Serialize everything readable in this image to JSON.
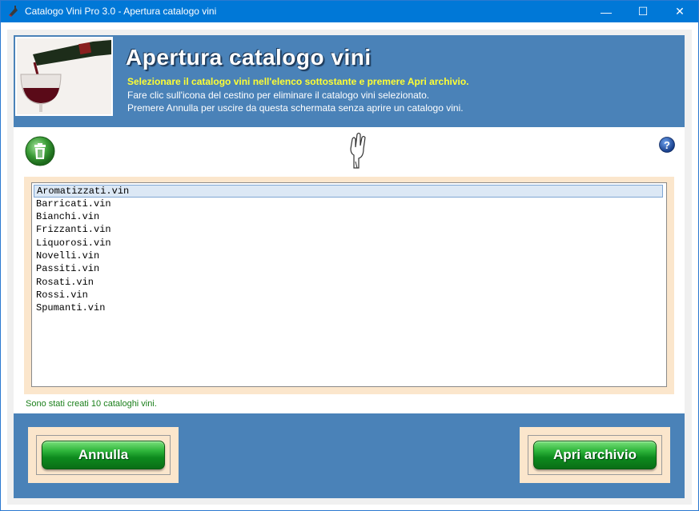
{
  "window": {
    "title": "Catalogo Vini Pro 3.0 - Apertura catalogo vini",
    "minimize_glyph": "—",
    "maximize_glyph": "☐",
    "close_glyph": "✕"
  },
  "header": {
    "title": "Apertura catalogo vini",
    "line1": "Selezionare il catalogo vini nell'elenco sottostante e premere Apri archivio.",
    "line2": "Fare clic sull'icona del cestino per eliminare il catalogo vini selezionato.",
    "line3": "Premere Annulla per uscire da questa schermata senza aprire un catalogo vini.",
    "photo_icon": "wine-pouring-photo"
  },
  "toolbar": {
    "trash_icon": "trash-icon",
    "hand_icon": "pointing-hand-icon",
    "help_glyph": "?"
  },
  "catalog_list": {
    "items": [
      {
        "label": "Aromatizzati.vin",
        "selected": true
      },
      {
        "label": "Barricati.vin",
        "selected": false
      },
      {
        "label": "Bianchi.vin",
        "selected": false
      },
      {
        "label": "Frizzanti.vin",
        "selected": false
      },
      {
        "label": "Liquorosi.vin",
        "selected": false
      },
      {
        "label": "Novelli.vin",
        "selected": false
      },
      {
        "label": "Passiti.vin",
        "selected": false
      },
      {
        "label": "Rosati.vin",
        "selected": false
      },
      {
        "label": "Rossi.vin",
        "selected": false
      },
      {
        "label": "Spumanti.vin",
        "selected": false
      }
    ]
  },
  "status": {
    "text": "Sono stati creati 10 cataloghi vini."
  },
  "footer": {
    "cancel_label": "Annulla",
    "open_label": "Apri archivio"
  },
  "colors": {
    "titlebar": "#0078d7",
    "banner": "#4a82b8",
    "accent_yellow": "#ffff33",
    "list_frame": "#fbe6cc",
    "status_green": "#1a7f1a",
    "button_green": "#0d8a1e"
  }
}
